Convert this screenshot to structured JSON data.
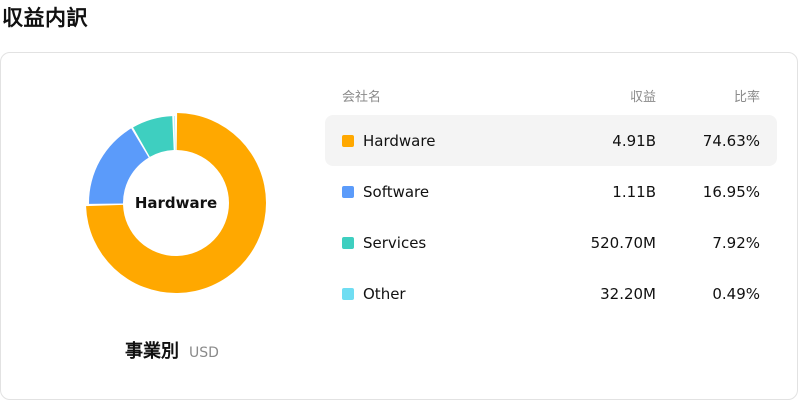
{
  "page": {
    "title": "収益内訳"
  },
  "caption": {
    "main": "事業別",
    "unit": "USD"
  },
  "table": {
    "headers": {
      "name": "会社名",
      "revenue": "収益",
      "ratio": "比率"
    },
    "rows": [
      {
        "name": "Hardware",
        "revenue": "4.91B",
        "ratio": "74.63%",
        "color": "#FFA800"
      },
      {
        "name": "Software",
        "revenue": "1.11B",
        "ratio": "16.95%",
        "color": "#5B9BFA"
      },
      {
        "name": "Services",
        "revenue": "520.70M",
        "ratio": "7.92%",
        "color": "#3ECFC0"
      },
      {
        "name": "Other",
        "revenue": "32.20M",
        "ratio": "0.49%",
        "color": "#6FDDF2"
      }
    ]
  },
  "chart_data": {
    "type": "pie",
    "title": "",
    "center_label": "Hardware",
    "categories": [
      "Hardware",
      "Software",
      "Services",
      "Other"
    ],
    "values": [
      74.63,
      16.95,
      7.92,
      0.49
    ],
    "colors": [
      "#FFA800",
      "#5B9BFA",
      "#3ECFC0",
      "#6FDDF2"
    ],
    "highlighted": "Hardware"
  }
}
